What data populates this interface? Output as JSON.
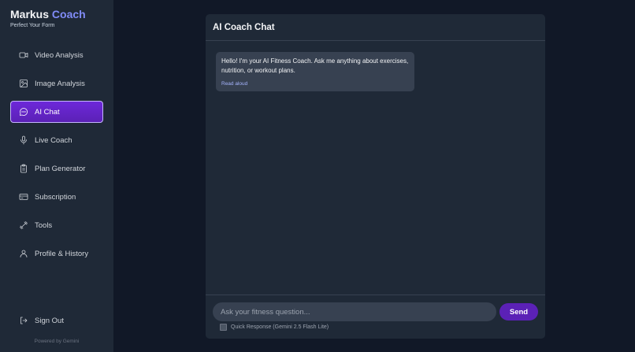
{
  "sidebar": {
    "brand_main": "Markus",
    "brand_accent": "Coach",
    "tagline": "Perfect Your Form",
    "items": [
      {
        "label": "Video Analysis",
        "icon": "video-icon"
      },
      {
        "label": "Image Analysis",
        "icon": "image-icon"
      },
      {
        "label": "AI Chat",
        "icon": "chat-icon",
        "active": true
      },
      {
        "label": "Live Coach",
        "icon": "microphone-icon"
      },
      {
        "label": "Plan Generator",
        "icon": "clipboard-icon"
      },
      {
        "label": "Subscription",
        "icon": "credit-card-icon"
      },
      {
        "label": "Tools",
        "icon": "dumbbell-icon"
      },
      {
        "label": "Profile & History",
        "icon": "user-icon"
      }
    ],
    "sign_out": {
      "label": "Sign Out",
      "icon": "sign-out-icon"
    },
    "powered_by": "Powered by Gemini"
  },
  "chat": {
    "title": "AI Coach Chat",
    "messages": [
      {
        "text": "Hello! I'm your AI Fitness Coach. Ask me anything about exercises, nutrition, or workout plans.",
        "action": "Read aloud"
      }
    ],
    "input_placeholder": "Ask your fitness question...",
    "input_value": "",
    "send_label": "Send",
    "quick_response_label": "Quick Response (Gemini 2.5 Flash Lite)",
    "quick_response_checked": false
  },
  "colors": {
    "background": "#111827",
    "panel": "#1f2937",
    "accent": "#818cf8",
    "active": "#5b21b6"
  }
}
